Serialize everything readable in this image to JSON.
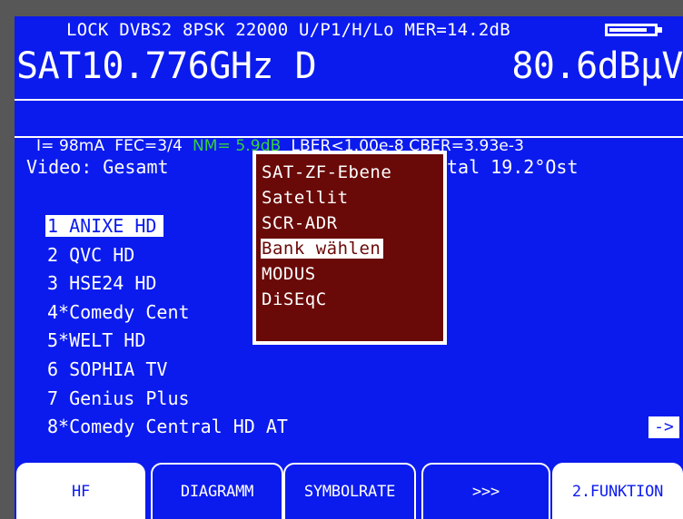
{
  "status": {
    "text": "LOCK DVBS2 8PSK 22000 U/P1/H/Lo MER=14.2dB",
    "battery_level": 0.85
  },
  "measurement": {
    "frequency": "SAT10.776GHz D",
    "level": "80.6dBµV"
  },
  "info": {
    "current": "I= 98mA",
    "fec": "FEC=3/4",
    "nm": "NM= 5.9dB",
    "lber": "LBER<1.00e-8",
    "cber": "CBER=3.93e-3"
  },
  "video": {
    "label": "Video: Gesamt",
    "satellite": "tal 19.2°Ost"
  },
  "channels": [
    {
      "label": "1 ANIXE HD",
      "selected": true
    },
    {
      "label": "2 QVC HD"
    },
    {
      "label": "3 HSE24 HD"
    },
    {
      "label": "4*Comedy Cent"
    },
    {
      "label": "5*WELT HD"
    },
    {
      "label": "6 SOPHIA TV"
    },
    {
      "label": "7 Genius Plus"
    },
    {
      "label": "8*Comedy Central HD AT"
    }
  ],
  "next_arrow": "->",
  "popup_menu": {
    "items": [
      "SAT-ZF-Ebene",
      "Satellit",
      "SCR-ADR",
      "Bank wählen",
      "MODUS",
      "DiSEqC"
    ],
    "active_index": 3
  },
  "function_keys": [
    "HF",
    "DIAGRAMM",
    "SYMBOLRATE",
    ">>>",
    "2.FUNKTION"
  ],
  "colors": {
    "screen_blue": "#0b1bee",
    "popup_red": "#6a0a08",
    "nm_green": "#36d23c"
  }
}
